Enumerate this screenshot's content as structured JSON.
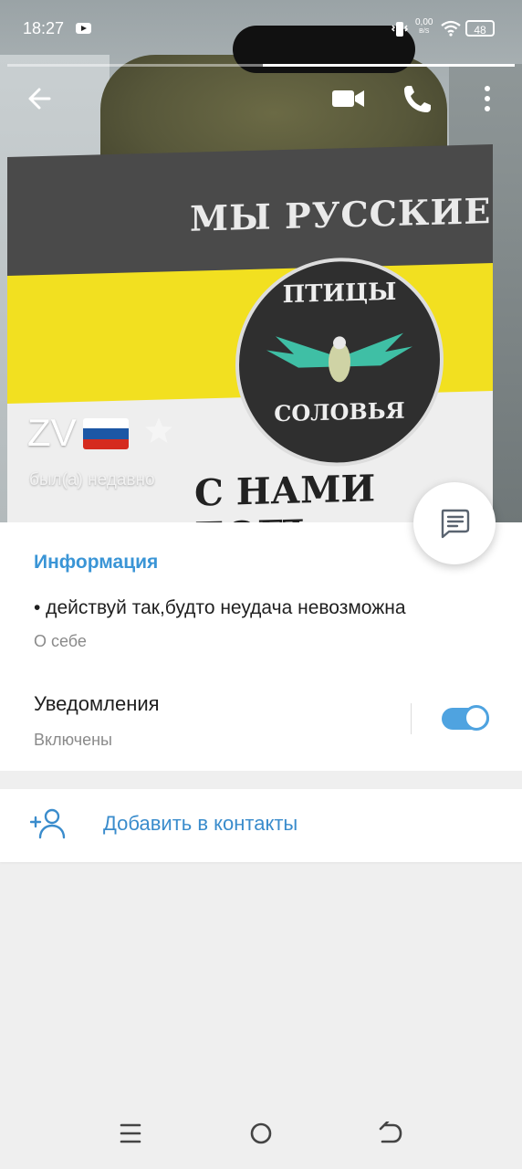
{
  "status_bar": {
    "time": "18:27",
    "net_speed_value": "0,00",
    "net_speed_unit": "B/S",
    "battery": "48"
  },
  "header_photo": {
    "flag_top_text": "МЫ РУССКИЕ",
    "emblem_top_text": "ПТИЦЫ",
    "emblem_bottom_text": "СОЛОВЬЯ",
    "flag_bottom_text": "С НАМИ БОГЪ"
  },
  "profile": {
    "name": "ZV",
    "last_seen": "был(а) недавно"
  },
  "info": {
    "title": "Информация",
    "bio": "• действуй так,будто неудача невозможна",
    "bio_label": "О себе",
    "notifications_title": "Уведомления",
    "notifications_state": "Включены",
    "notifications_enabled": true
  },
  "actions": {
    "add_contact": "Добавить в контакты"
  },
  "colors": {
    "accent": "#3a95d6",
    "toggle": "#4fa3e0",
    "background": "#efefef"
  },
  "icons": [
    "back-arrow-icon",
    "video-call-icon",
    "phone-icon",
    "more-vert-icon",
    "star-icon",
    "message-icon",
    "add-contact-icon",
    "menu-icon",
    "home-icon",
    "back-nav-icon"
  ]
}
